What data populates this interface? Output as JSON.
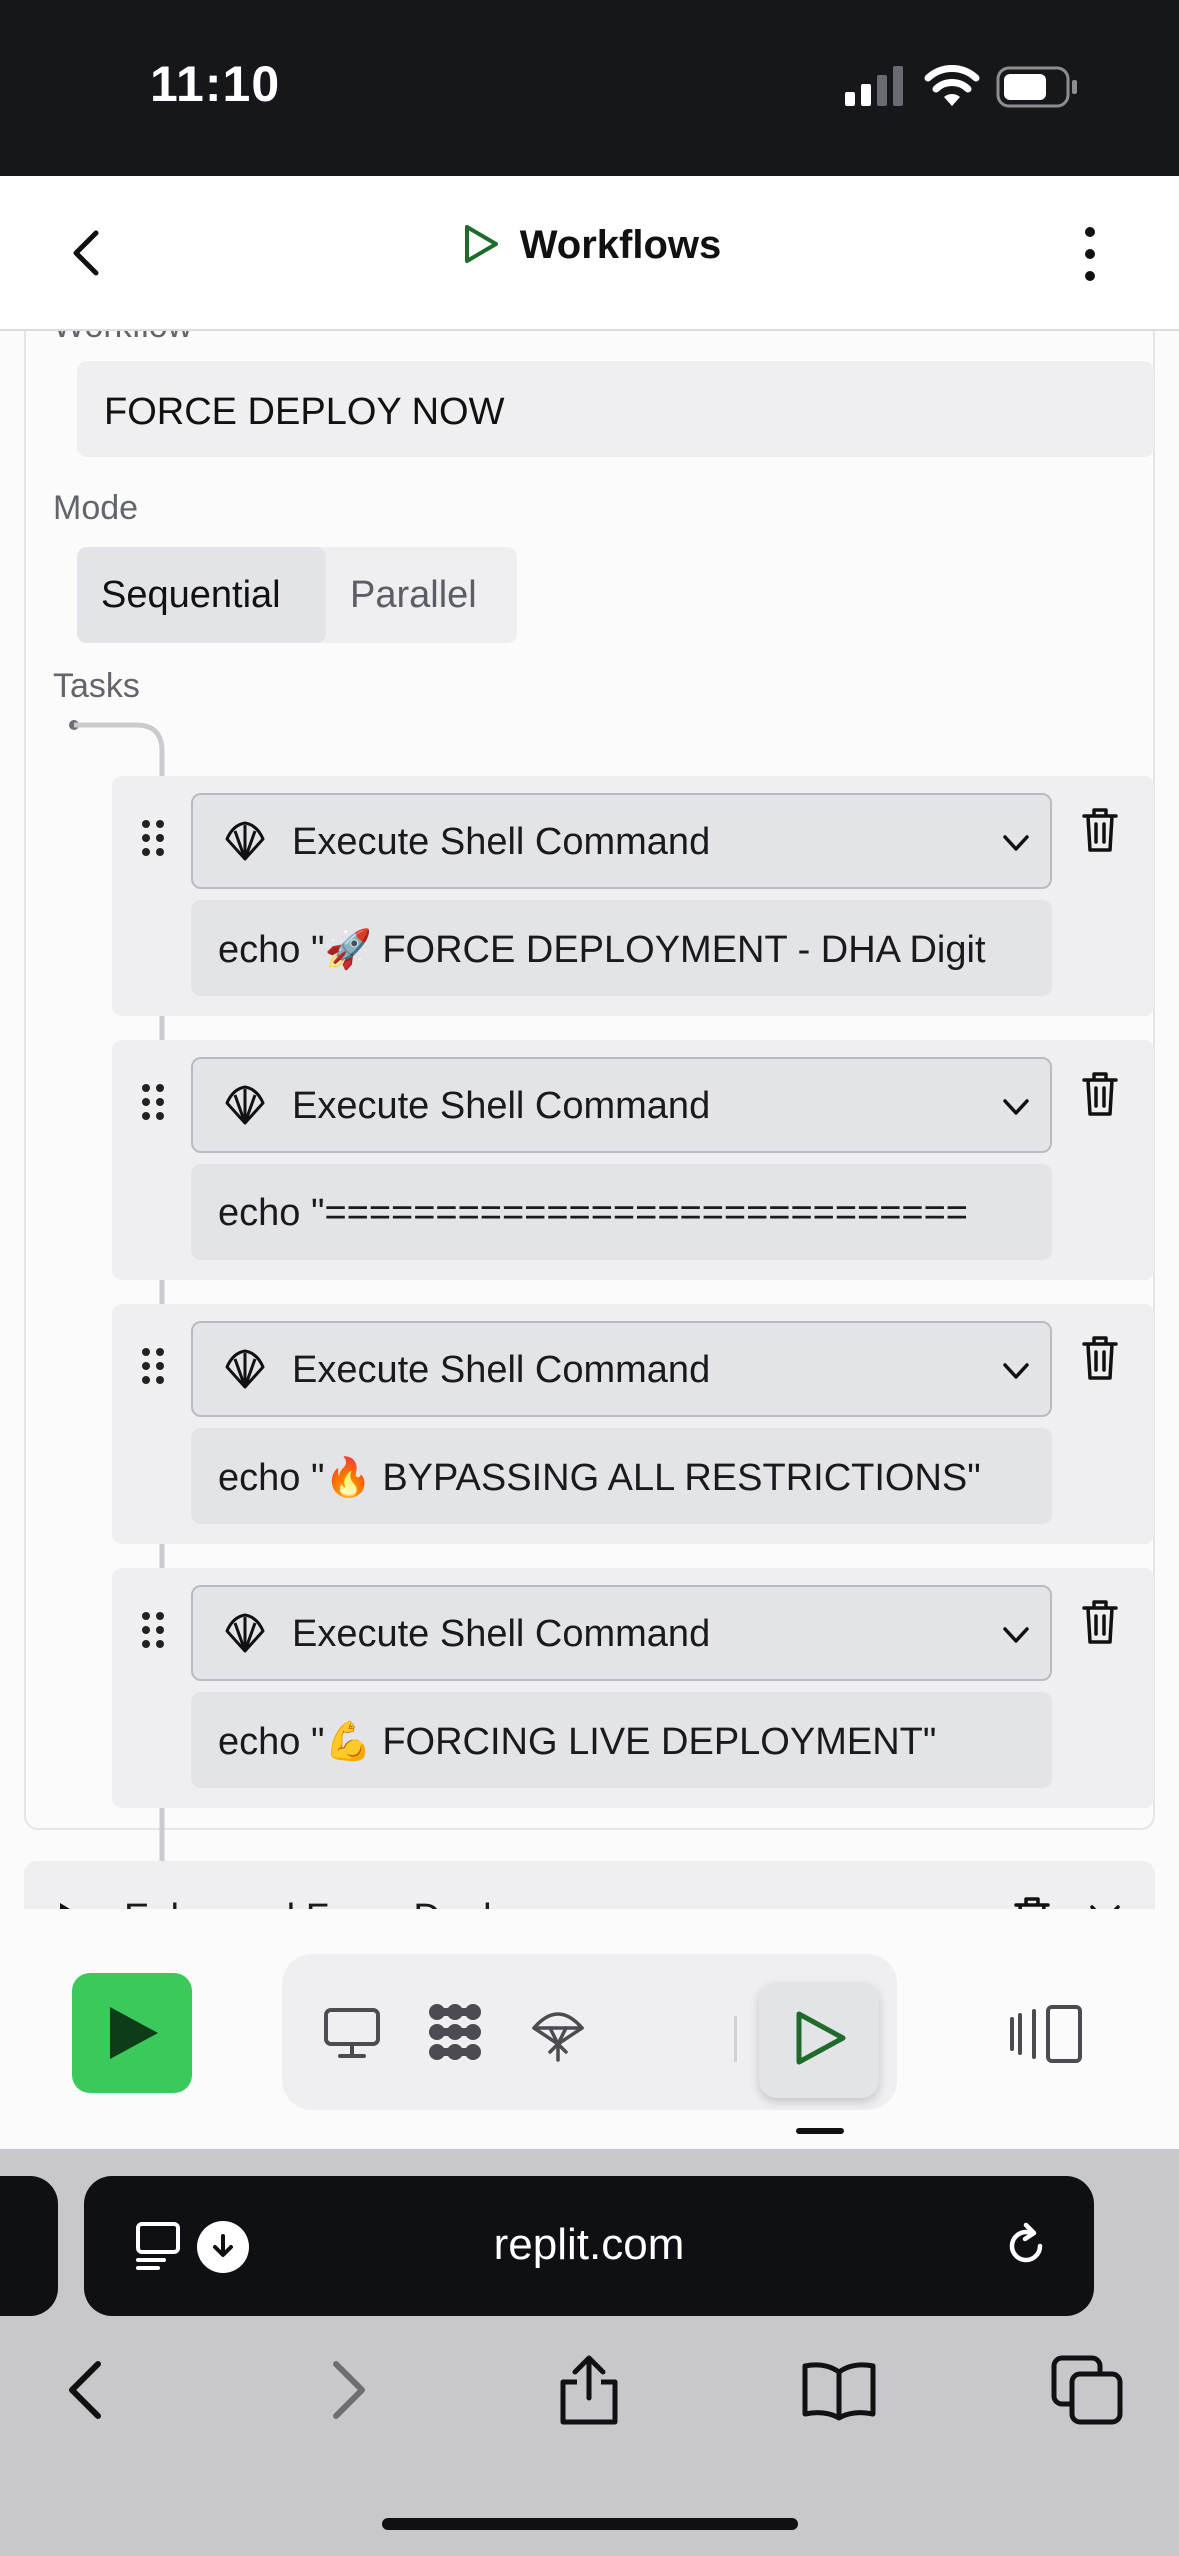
{
  "status_bar": {
    "time": "11:10"
  },
  "header": {
    "title": "Workflows"
  },
  "workflow": {
    "name_label": "Workflow",
    "name_value": "FORCE DEPLOY NOW",
    "mode_label": "Mode",
    "modes": [
      "Sequential",
      "Parallel"
    ],
    "selected_mode": "Sequential",
    "tasks_label": "Tasks",
    "tasks": [
      {
        "type": "Execute Shell Command",
        "command": "echo \"🚀 FORCE DEPLOYMENT - DHA Digit"
      },
      {
        "type": "Execute Shell Command",
        "command": "echo \"============================="
      },
      {
        "type": "Execute Shell Command",
        "command": "echo \"🔥 BYPASSING ALL RESTRICTIONS\""
      },
      {
        "type": "Execute Shell Command",
        "command": "echo \"💪 FORCING LIVE DEPLOYMENT\""
      }
    ]
  },
  "next_workflow": {
    "title": "Enhanced Force Deploy"
  },
  "toolbar": {
    "tools": [
      "desktop-icon",
      "nodes-icon",
      "deploy-icon",
      "workflows-play-icon"
    ],
    "selected_tool": "workflows-play-icon"
  },
  "browser": {
    "url": "replit.com"
  },
  "colors": {
    "accent_green": "#3bc95c",
    "play_outline": "#1e6b2c",
    "bar_dark": "#0f1013"
  }
}
